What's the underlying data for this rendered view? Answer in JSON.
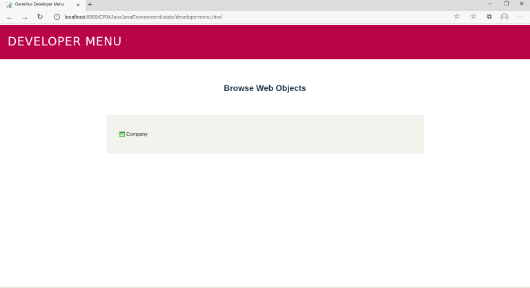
{
  "browser": {
    "tab": {
      "title": "GeneXus Developer Menu",
      "close_glyph": "×",
      "favicon": "genexus-favicon-icon"
    },
    "new_tab_glyph": "+",
    "window": {
      "minimize": "–",
      "restore": "❐",
      "close": "✕"
    },
    "nav": {
      "back": "←",
      "forward": "→",
      "reload": "↻"
    },
    "url": {
      "host": "localhost",
      "path": ":8089/CRMJavaJavaEnvironment/static/developermenu.html"
    },
    "tools": {
      "favorite": "☆",
      "favorites_list": "☆",
      "collections": "⧉",
      "more": "···"
    }
  },
  "header": {
    "title": "DEVELOPER MENU",
    "color": "#b90545"
  },
  "main": {
    "heading": "Browse Web Objects",
    "objects": [
      {
        "label": "Company",
        "icon": "web-panel-icon"
      }
    ]
  }
}
